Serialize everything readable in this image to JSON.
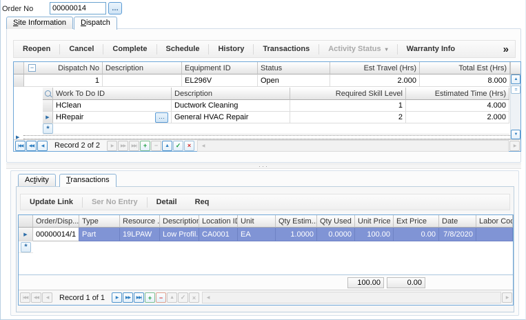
{
  "order": {
    "label": "Order No",
    "value": "00000014",
    "browse_icon": "…"
  },
  "main_tabs": {
    "site": {
      "key": "S",
      "post": "ite Information"
    },
    "dispatch": {
      "key": "D",
      "post": "ispatch"
    }
  },
  "dispatch_panel": {
    "toolbar": {
      "reopen": "Reopen",
      "cancel": "Cancel",
      "complete": "Complete",
      "schedule": "Schedule",
      "history": "History",
      "transactions": "Transactions",
      "activity_status": "Activity Status",
      "warranty_info": "Warranty Info",
      "overflow_icon": "»",
      "dropdown_icon": "▾"
    },
    "grid": {
      "headers": {
        "dispatch_no": "Dispatch No",
        "description": "Description",
        "equipment_id": "Equipment ID",
        "status": "Status",
        "est_travel": "Est Travel (Hrs)",
        "total_est": "Total Est (Hrs)"
      },
      "row": {
        "collapse_icon": "−",
        "dispatch_no": "1",
        "description": "",
        "equipment_id": "EL296V",
        "status": "Open",
        "est_travel": "2.000",
        "total_est": "8.000"
      },
      "detail": {
        "headers": {
          "work_to_do_id": "Work To Do ID",
          "description": "Description",
          "required_skill_level": "Required Skill Level",
          "estimated_time": "Estimated Time (Hrs)"
        },
        "rows": [
          {
            "work_to_do_id": "HClean",
            "description": "Ductwork Cleaning",
            "required_skill_level": "1",
            "estimated_time": "4.000"
          },
          {
            "work_to_do_id": "HRepair",
            "browse_icon": "…",
            "description": "General HVAC Repair",
            "required_skill_level": "2",
            "estimated_time": "2.000"
          }
        ],
        "new_row_icon": "*"
      },
      "nav": {
        "status": "Record 2 of 2"
      }
    }
  },
  "lower_tabs": {
    "activity": {
      "pre": "Ac",
      "key": "t",
      "post": "ivity"
    },
    "transactions": {
      "key": "T",
      "post": "ransactions"
    }
  },
  "transactions_panel": {
    "toolbar": {
      "update_link": "Update Link",
      "ser_no_entry": "Ser No Entry",
      "detail": "Detail",
      "req": "Req"
    },
    "grid": {
      "headers": [
        "Order/Disp...",
        "Type",
        "Resource ...",
        "Description",
        "Location ID",
        "Unit",
        "Qty Estim...",
        "Qty Used",
        "Unit Price",
        "Ext Price",
        "Date",
        "Labor Code"
      ],
      "row": [
        "00000014/1",
        "Part",
        "19LPAW",
        "Low Profil...",
        "CA0001",
        "EA",
        "1.0000",
        "0.0000",
        "100.00",
        "0.00",
        "7/8/2020",
        ""
      ],
      "new_row_icon": "*",
      "totals": {
        "unit_price": "100.00",
        "ext_price": "0.00"
      },
      "nav": {
        "status": "Record 1 of 1"
      }
    }
  },
  "icons": {
    "nav_first": "|◀◀",
    "nav_prev_page": "◀◀",
    "nav_prev": "◀",
    "nav_next": "▶",
    "nav_next_page": "▶▶",
    "nav_last": "▶▶|",
    "append": "+",
    "delete": "−",
    "edit": "▲",
    "post": "✓",
    "cancel": "×",
    "scroll_left": "◀",
    "scroll_right": "▶",
    "scroll_up": "▲",
    "scroll_down": "▼",
    "thumb": "=",
    "row_arrow": "▶",
    "splitter_dots": "···"
  }
}
